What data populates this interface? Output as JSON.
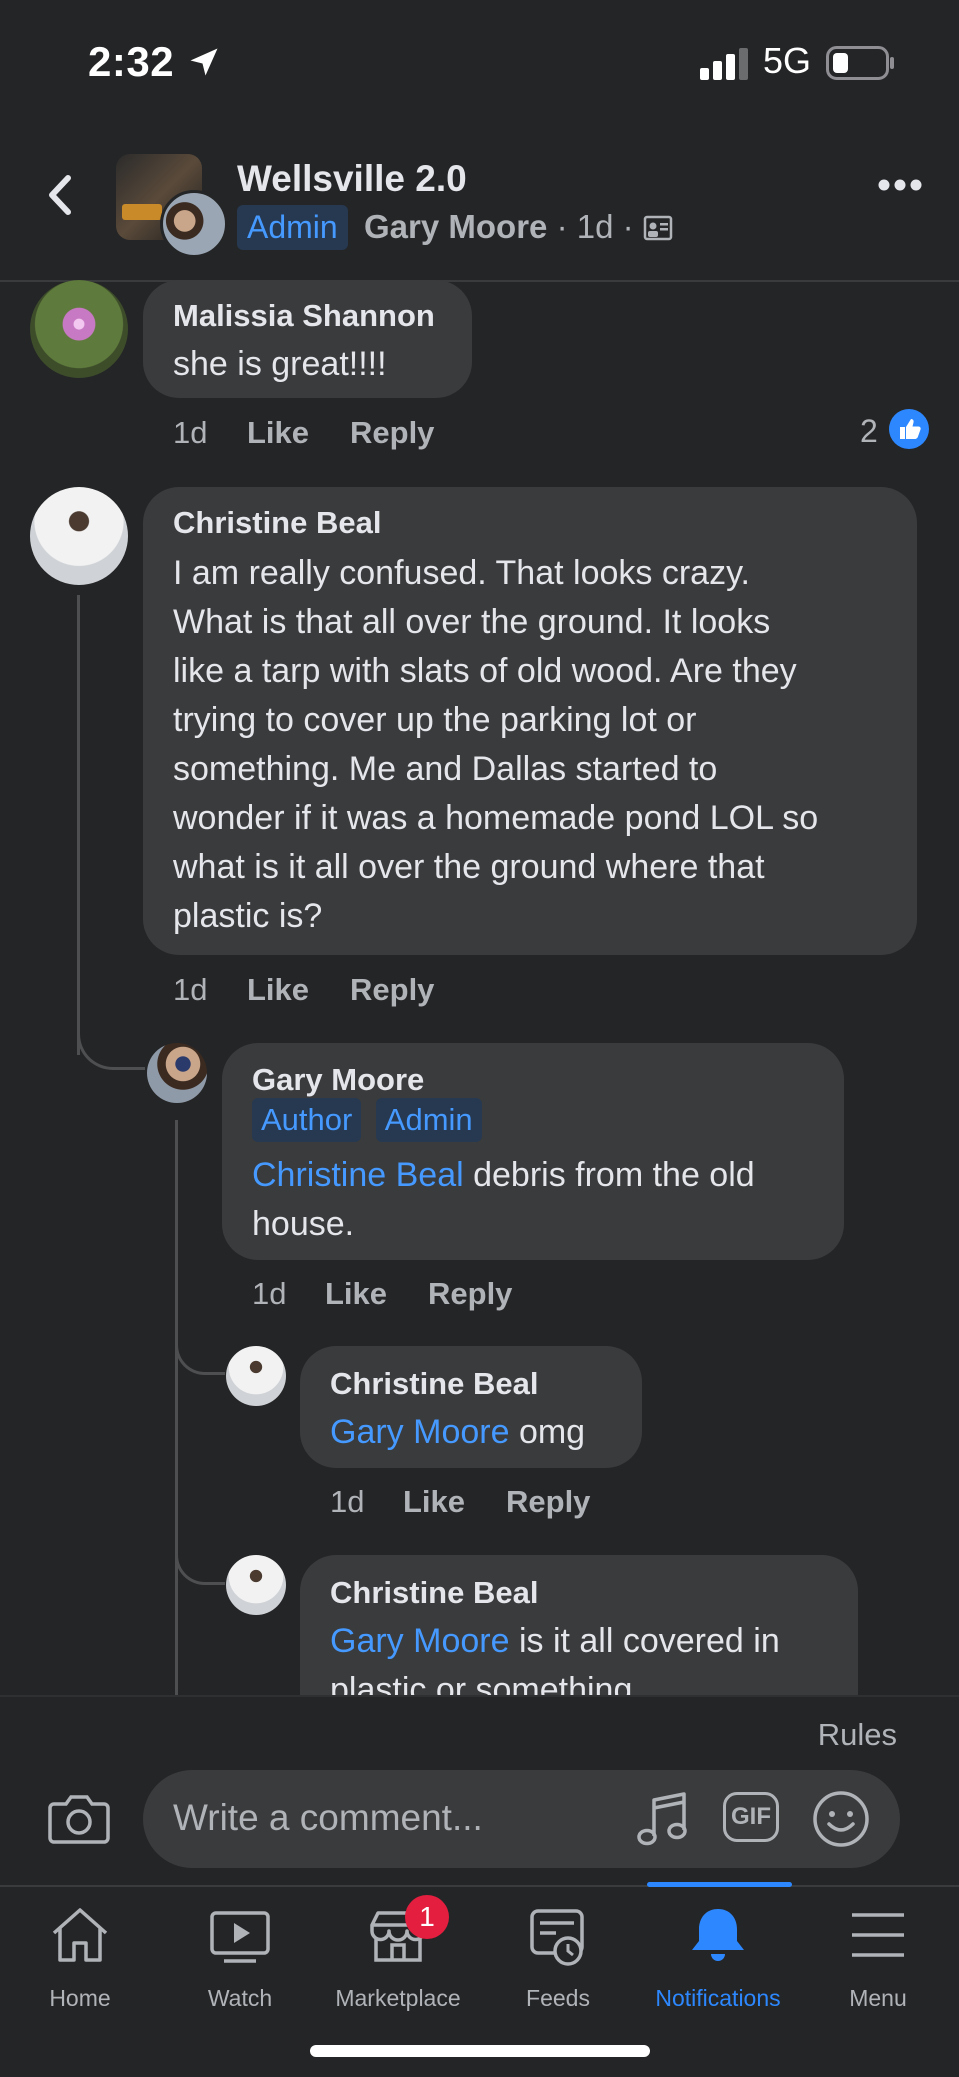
{
  "status_bar": {
    "time": "2:32",
    "network": "5G"
  },
  "header": {
    "group_name": "Wellsville 2.0",
    "badge": "Admin",
    "author": "Gary Moore",
    "age": "1d",
    "separator": "·"
  },
  "comments": [
    {
      "name": "Malissia Shannon",
      "text": "she is great!!!!",
      "age": "1d",
      "like": "Like",
      "reply": "Reply",
      "reaction_count": "2"
    },
    {
      "name": "Christine Beal",
      "lines": [
        "I am really confused. That looks crazy.",
        "What is that all over the ground. It looks",
        "like a tarp with slats of old wood. Are they",
        "trying to cover up the parking lot or",
        "something. Me and Dallas started to",
        "wonder if it was a homemade pond LOL so",
        "what is it all over the ground where that",
        "plastic is?"
      ],
      "age": "1d",
      "like": "Like",
      "reply": "Reply"
    },
    {
      "name": "Gary Moore",
      "tags": [
        "Author",
        "Admin"
      ],
      "mention": "Christine Beal",
      "text_line1": " debris from the old",
      "text_line2": "house.",
      "age": "1d",
      "like": "Like",
      "reply": "Reply"
    },
    {
      "name": "Christine Beal",
      "mention": "Gary Moore",
      "text": " omg",
      "age": "1d",
      "like": "Like",
      "reply": "Reply"
    },
    {
      "name": "Christine Beal",
      "mention": "Gary Moore",
      "text_line1": " is it all covered in",
      "text_line2": "plastic or something"
    }
  ],
  "composer": {
    "rules": "Rules",
    "placeholder": "Write a comment...",
    "gif": "GIF"
  },
  "tabs": [
    {
      "label": "Home",
      "icon": "home-icon"
    },
    {
      "label": "Watch",
      "icon": "watch-icon"
    },
    {
      "label": "Marketplace",
      "icon": "marketplace-icon",
      "badge": "1"
    },
    {
      "label": "Feeds",
      "icon": "feeds-icon"
    },
    {
      "label": "Notifications",
      "icon": "bell-icon",
      "active": true
    },
    {
      "label": "Menu",
      "icon": "menu-icon"
    }
  ],
  "colors": {
    "accent": "#2d88ff",
    "mention": "#4599ff",
    "badge_red": "#e41e3f",
    "background": "#242526",
    "bubble": "#3a3b3c"
  }
}
